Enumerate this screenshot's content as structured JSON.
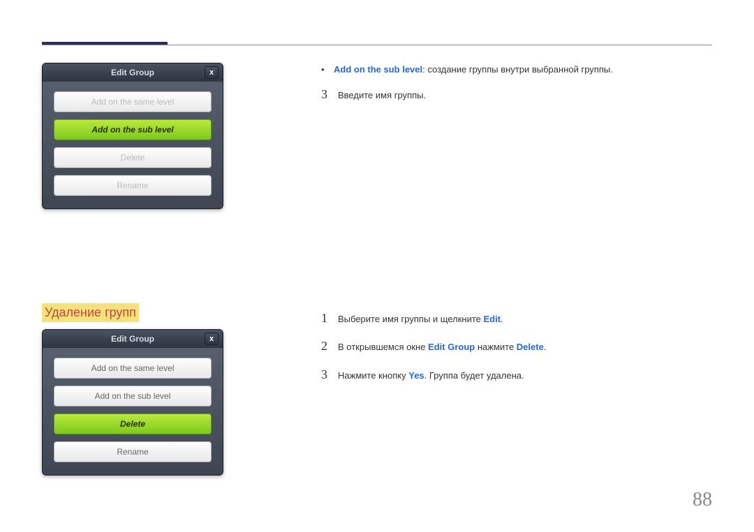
{
  "page_number": "88",
  "dialog1": {
    "title": "Edit Group",
    "close": "x",
    "options": [
      {
        "label": "Add on the same level",
        "state": "dimmed"
      },
      {
        "label": "Add on the sub level",
        "state": "active"
      },
      {
        "label": "Delete",
        "state": "dimmed"
      },
      {
        "label": "Rename",
        "state": "dimmed"
      }
    ]
  },
  "dialog2": {
    "title": "Edit Group",
    "close": "x",
    "options": [
      {
        "label": "Add on the same level",
        "state": "normal"
      },
      {
        "label": "Add on the sub level",
        "state": "normal"
      },
      {
        "label": "Delete",
        "state": "active"
      },
      {
        "label": "Rename",
        "state": "normal"
      }
    ]
  },
  "section1": {
    "bullet": "•",
    "bullet_highlight": "Add on the sub level",
    "bullet_rest": ": создание группы внутри выбранной группы.",
    "step3_num": "3",
    "step3_text": "Введите имя группы."
  },
  "section2": {
    "heading": "Удаление групп",
    "step1_num": "1",
    "step1_a": "Выберите имя группы и щелкните ",
    "step1_hl": "Edit",
    "step1_b": ".",
    "step2_num": "2",
    "step2_a": "В открывшемся окне ",
    "step2_hl1": "Edit Group",
    "step2_b": " нажмите ",
    "step2_hl2": "Delete",
    "step2_c": ".",
    "step3_num": "3",
    "step3_a": "Нажмите кнопку ",
    "step3_hl": "Yes",
    "step3_b": ". Группа будет удалена."
  }
}
